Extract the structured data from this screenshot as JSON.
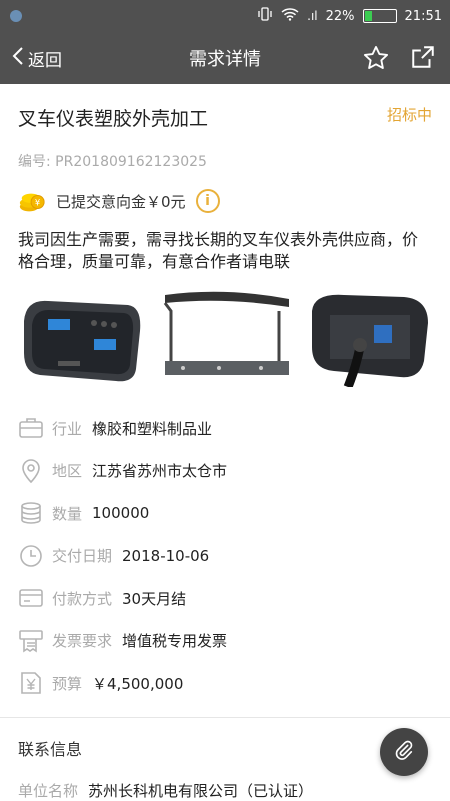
{
  "status_bar": {
    "battery_percent": "22%",
    "battery_level": 0.22,
    "time": "21:51",
    "signal_label": ".ıl"
  },
  "nav": {
    "back_label": "返回",
    "title": "需求详情"
  },
  "requirement": {
    "title": "叉车仪表塑胶外壳加工",
    "status": "招标中",
    "code_label": "编号:",
    "code_value": "PR201809162123025",
    "deposit_text": "已提交意向金￥0元",
    "description": "我司因生产需要，需寻找长期的叉车仪表外壳供应商，价格合理，质量可靠，有意合作者请电联"
  },
  "details": [
    {
      "icon": "briefcase-icon",
      "label": "行业",
      "value": "橡胶和塑料制品业"
    },
    {
      "icon": "location-pin-icon",
      "label": "地区",
      "value": "江苏省苏州市太仓市"
    },
    {
      "icon": "database-icon",
      "label": "数量",
      "value": "100000"
    },
    {
      "icon": "clock-icon",
      "label": "交付日期",
      "value": "2018-10-06"
    },
    {
      "icon": "credit-card-icon",
      "label": "付款方式",
      "value": "30天月结"
    },
    {
      "icon": "invoice-icon",
      "label": "发票要求",
      "value": "增值税专用发票"
    },
    {
      "icon": "budget-icon",
      "label": "预算",
      "value": "￥4,500,000"
    }
  ],
  "contact": {
    "section_title": "联系信息",
    "company_label": "单位名称",
    "company_value": "苏州长科机电有限公司（已认证）"
  },
  "colors": {
    "header_bg": "#505050",
    "accent": "#e3a534",
    "label_gray": "#aaaaaa"
  }
}
